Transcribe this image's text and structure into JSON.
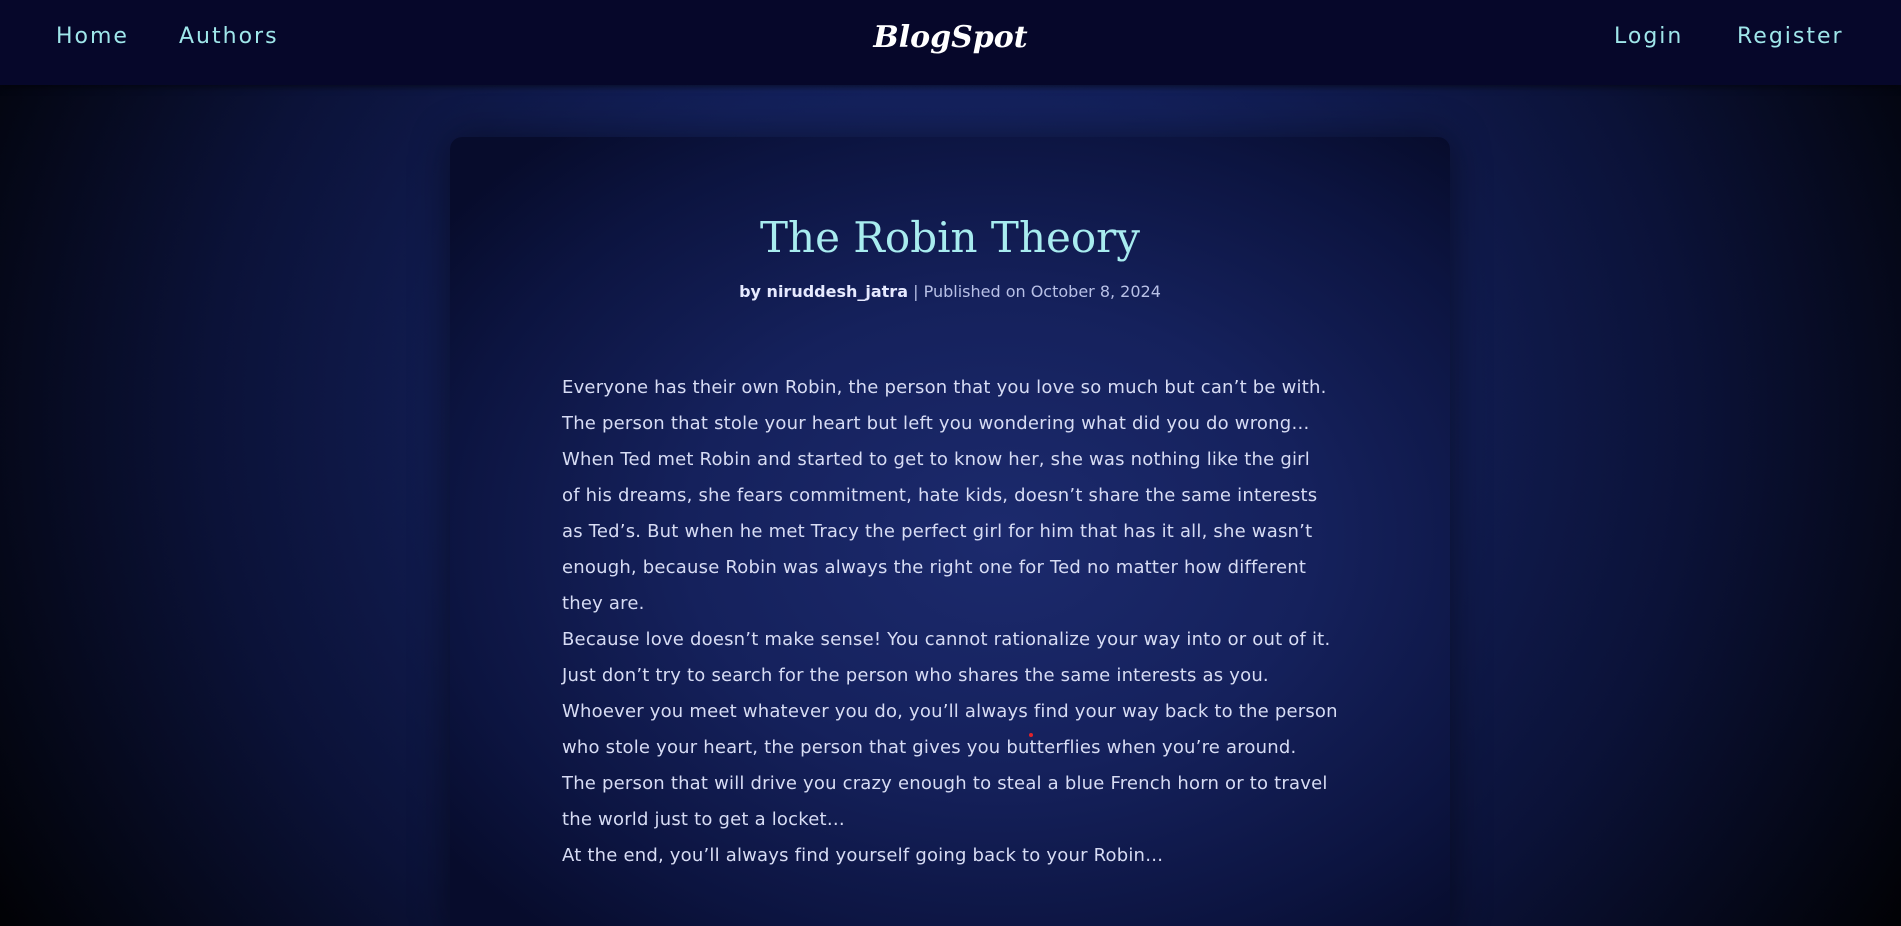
{
  "nav": {
    "home": "Home",
    "authors": "Authors",
    "brand": "BlogSpot",
    "login": "Login",
    "register": "Register"
  },
  "post": {
    "title": "The Robin Theory",
    "author_prefix": "by",
    "author": "niruddesh_jatra",
    "separator": "|",
    "published": "Published on October 8, 2024",
    "lines": [
      "Everyone has their own Robin, the person that you love so much but can’t be with.",
      "The person that stole your heart but left you wondering what did you do wrong…",
      "When Ted met Robin and started to get to know her, she was nothing like the girl",
      "of his dreams, she fears commitment, hate kids, doesn’t share the same interests",
      "as Ted’s. But when he met Tracy the perfect girl for him that has it all, she wasn’t",
      "enough, because Robin was always the right one for Ted no matter how different",
      "they are.",
      "Because love doesn’t make sense! You cannot rationalize your way into or out of it.",
      "Just don’t try to search for the person who shares the same interests as you.",
      "Whoever you meet whatever you do, you’ll always find your way back to the person",
      "who stole your heart, the person that gives you butterflies when you’re around.",
      "The person that will drive you crazy enough to steal a blue French horn or to travel",
      "the world just to get a locket…",
      "At the end, you’ll always find yourself going back to your Robin…"
    ]
  },
  "colors": {
    "accent": "#9fe6ea",
    "title": "#a8ecef",
    "navbar_bg": "#06072a"
  }
}
